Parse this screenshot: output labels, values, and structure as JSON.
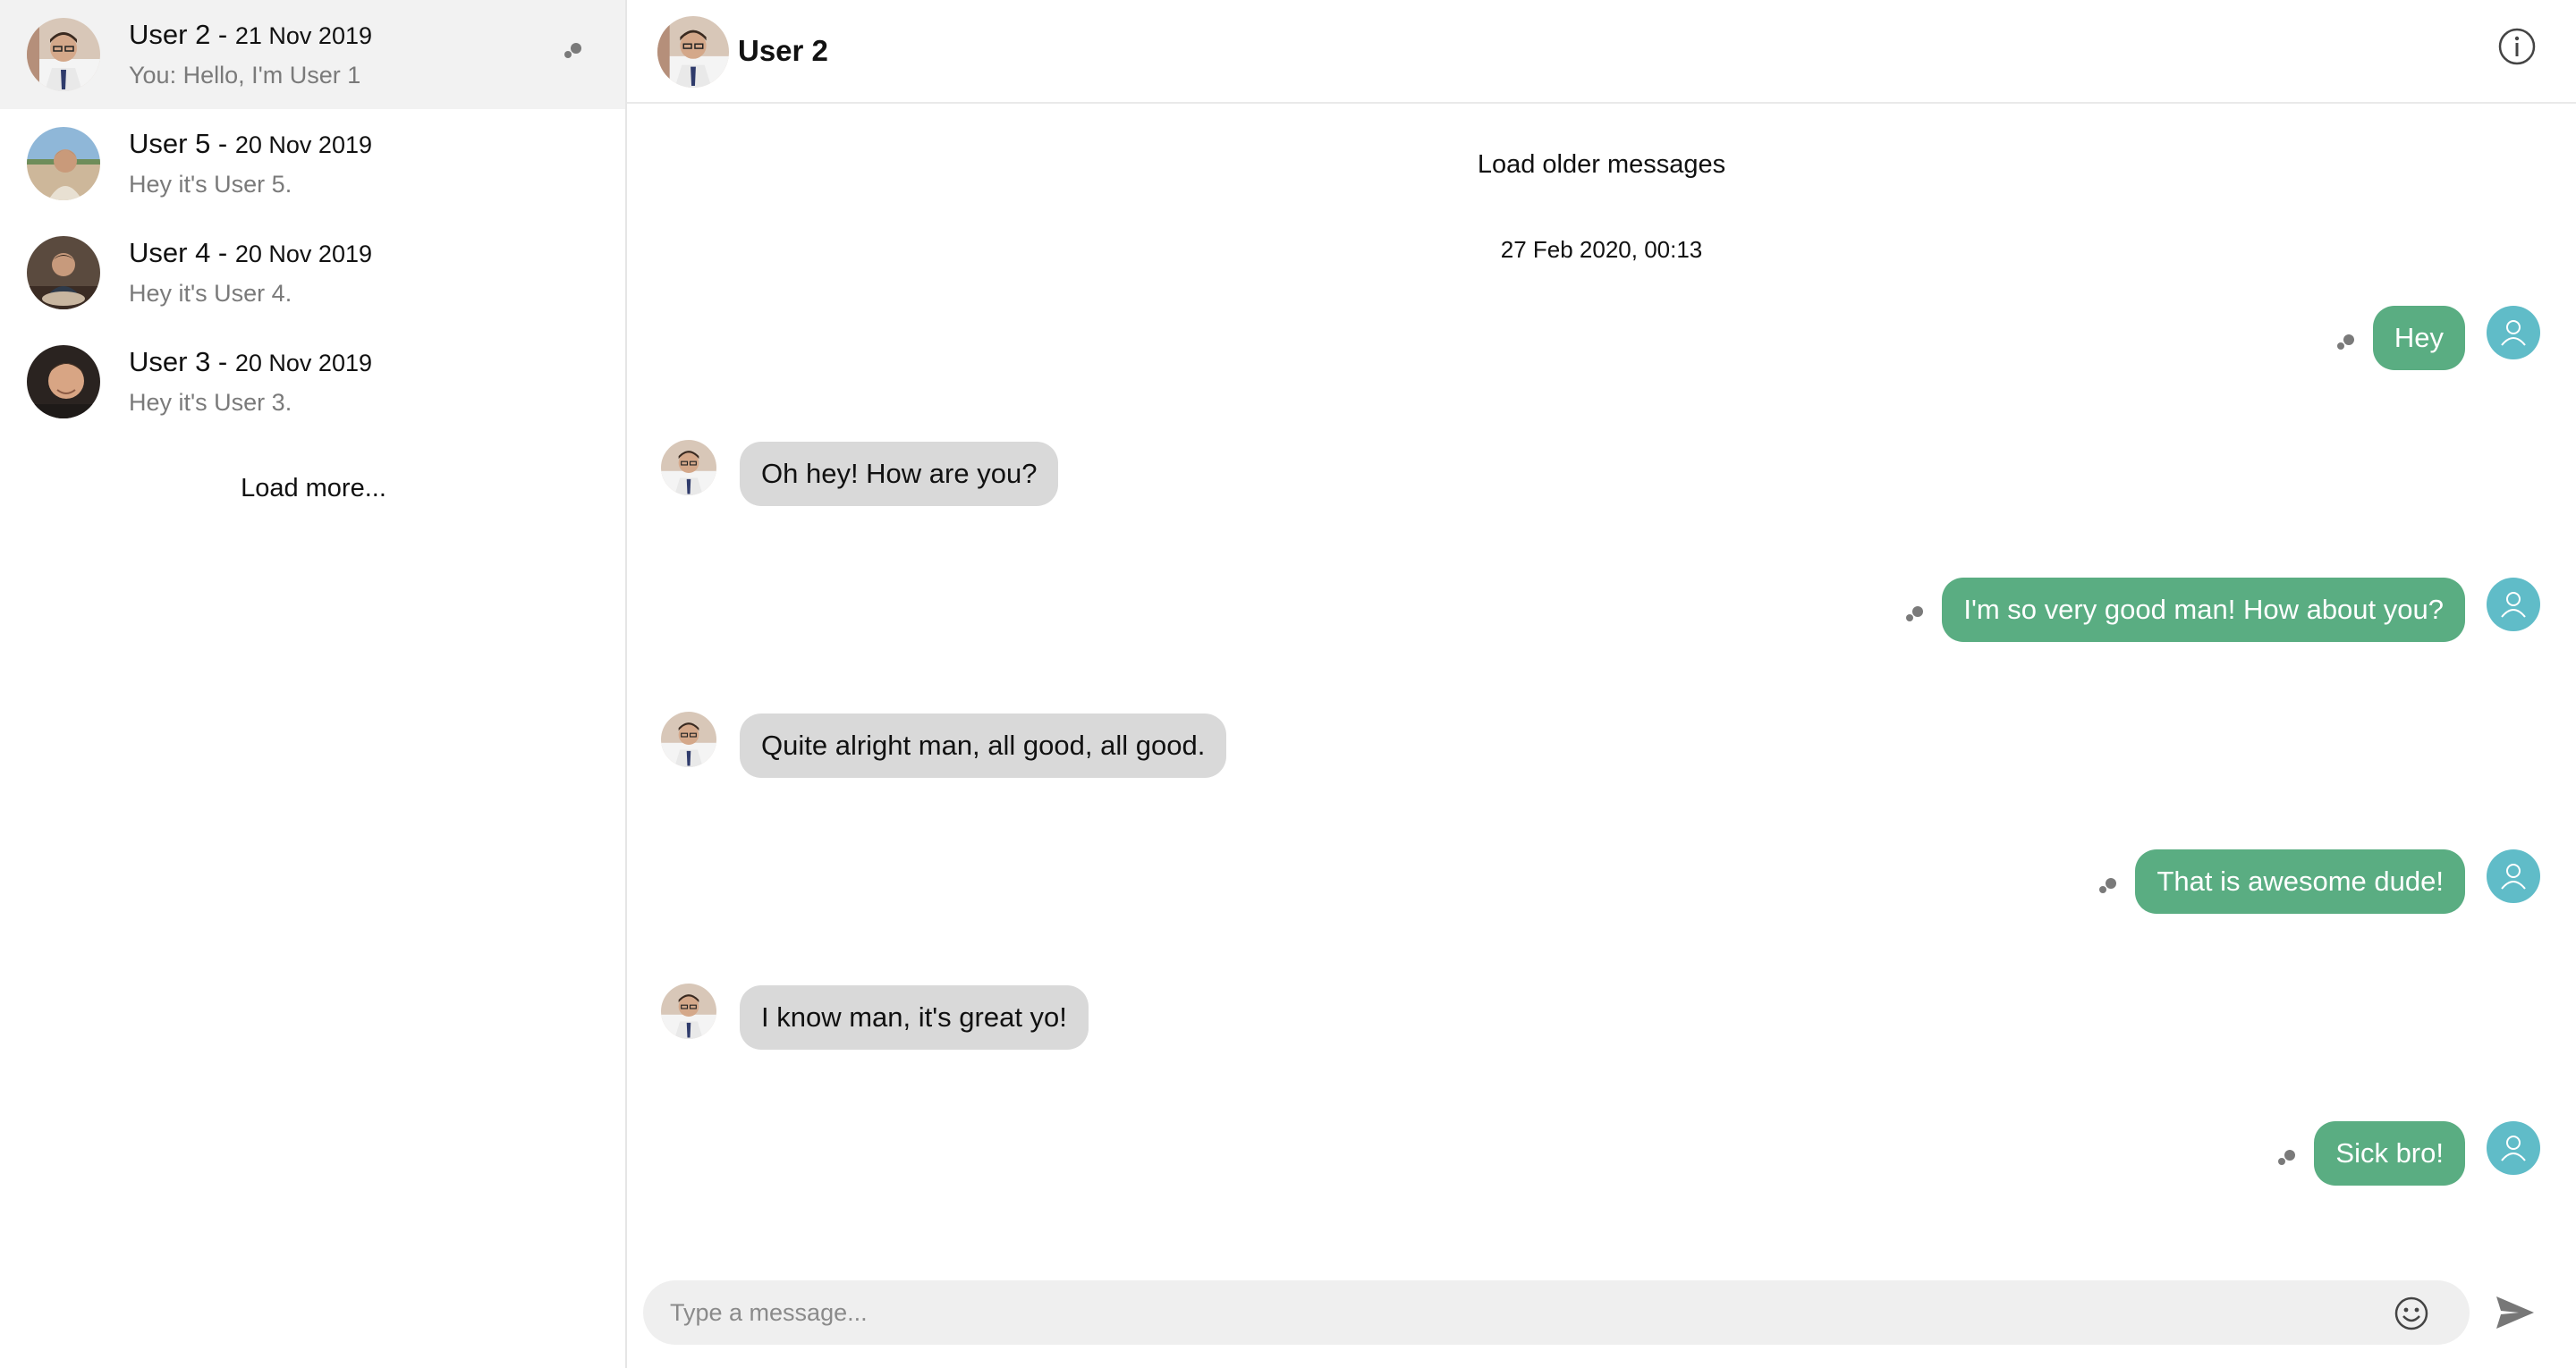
{
  "sidebar": {
    "conversations": [
      {
        "name": "User 2",
        "date": "21 Nov 2019",
        "preview": "You: Hello, I'm User 1",
        "active": true
      },
      {
        "name": "User 5",
        "date": "20 Nov 2019",
        "preview": "Hey it's User 5."
      },
      {
        "name": "User 4",
        "date": "20 Nov 2019",
        "preview": "Hey it's User 4."
      },
      {
        "name": "User 3",
        "date": "20 Nov 2019",
        "preview": "Hey it's User 3."
      }
    ],
    "separator": " - ",
    "load_more": "Load more..."
  },
  "chat": {
    "title": "User 2",
    "load_older": "Load older messages",
    "timestamp": "27 Feb 2020, 00:13",
    "messages": [
      {
        "from": "me",
        "text": "Hey"
      },
      {
        "from": "them",
        "text": "Oh hey! How are you?"
      },
      {
        "from": "me",
        "text": "I'm so very good man! How about you?"
      },
      {
        "from": "them",
        "text": "Quite alright man, all good, all good."
      },
      {
        "from": "me",
        "text": "That is awesome dude!"
      },
      {
        "from": "them",
        "text": "I know man, it's great yo!"
      },
      {
        "from": "me",
        "text": "Sick bro!"
      }
    ]
  },
  "composer": {
    "placeholder": "Type a message..."
  },
  "icons": {
    "info": "info-icon",
    "emoji": "emoji-icon",
    "send": "send-icon",
    "seen": "seen-indicator-icon",
    "my_avatar": "user-outline-icon"
  },
  "colors": {
    "outgoing_bubble": "#5aad82",
    "incoming_bubble": "#d9d9d9",
    "my_avatar_bg": "#60bcc8",
    "active_conversation_bg": "#f2f2f2"
  }
}
